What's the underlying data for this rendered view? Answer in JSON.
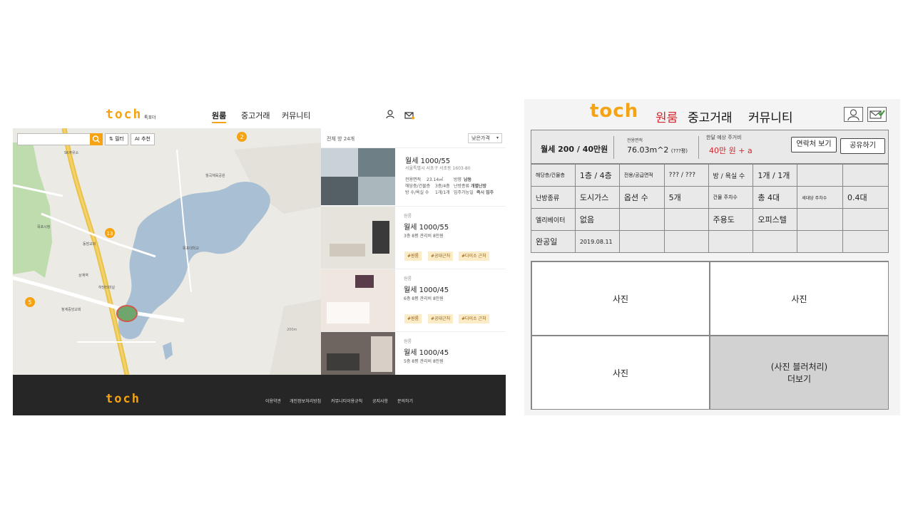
{
  "left": {
    "brand": "toch",
    "brand_sub": "톡포더",
    "nav": [
      "원룸",
      "중고거래",
      "커뮤니티"
    ],
    "map": {
      "filter_label": "필터",
      "ai_label": "AI 추천",
      "markers": [
        "2",
        "13",
        "5"
      ],
      "places": [
        "SK주유소",
        "동방교회",
        "목포대학교",
        "월곡체육공원",
        "상계역",
        "하당터미널",
        "목포시청",
        "청계중앙교회"
      ],
      "scale": "200m"
    },
    "list": {
      "total": "전체 방 24개",
      "sort": "낮은가격",
      "featured": {
        "price": "월세 1000/55",
        "address": "서울특별시 서초구 서초동 1603-80",
        "area_label": "전용면적",
        "area_value": "23.14㎡",
        "floor_label": "해당층/건물층",
        "floor_value": "3층/4층",
        "rooms_label": "방 수/욕실 수",
        "rooms_value": "1개/1개",
        "dir_label": "방향",
        "dir_value": "남동",
        "heat_label": "난방종류",
        "heat_value": "개별난방",
        "move_label": "입주가능일",
        "move_value": "즉시 입주"
      },
      "cards": [
        {
          "type": "원룸",
          "price": "월세 1000/55",
          "detail": "3층 8평 관리비 8만원",
          "tags": [
            "#원룸",
            "#공대근처",
            "#다이소 근처"
          ]
        },
        {
          "type": "원룸",
          "price": "월세 1000/45",
          "detail": "6층 8평 관리비 8만원",
          "tags": [
            "#원룸",
            "#공대근처",
            "#다이소 근처"
          ]
        },
        {
          "type": "원룸",
          "price": "월세 1000/45",
          "detail": "5층 8평 관리비 8만원",
          "tags": []
        }
      ]
    },
    "footer": {
      "brand": "toch",
      "links": [
        "이용약관",
        "개인정보처리방침",
        "커뮤니티이용규칙",
        "공지사항",
        "문의하기"
      ]
    }
  },
  "right": {
    "brand": "toch",
    "nav": [
      "원룸",
      "중고거래",
      "커뮤니티"
    ],
    "summary": {
      "rent": "월세 200 / 40만원",
      "area_label": "전용면적",
      "area_value": "76.03m^2",
      "area_py": "(???평)",
      "cost_label": "한달 예상 주거비",
      "cost_value": "40만 원 + a",
      "contact_button": "연락처 보기",
      "share_button": "공유하기"
    },
    "table": {
      "r1": [
        "해당층/건물층",
        "1층 / 4층",
        "전용/공급면적",
        "??? / ???",
        "방 / 욕실 수",
        "1개 / 1개",
        "",
        ""
      ],
      "r2": [
        "난방종류",
        "도시가스",
        "옵션 수",
        "5개",
        "건물 주차수",
        "총 4대",
        "세대당 주차수",
        "0.4대"
      ],
      "r3": [
        "엘리베이터",
        "없음",
        "",
        "",
        "주용도",
        "오피스텔",
        "",
        ""
      ],
      "r4": [
        "완공일",
        "2019.08.11",
        "",
        "",
        "",
        "",
        "",
        ""
      ]
    },
    "photos": {
      "p1": "사진",
      "p2": "사진",
      "p3": "사진",
      "p4_line1": "(사진 블러처리)",
      "p4_line2": "더보기"
    }
  },
  "colors": {
    "brand_orange": "#f5a312",
    "accent_red": "#d2262e"
  }
}
